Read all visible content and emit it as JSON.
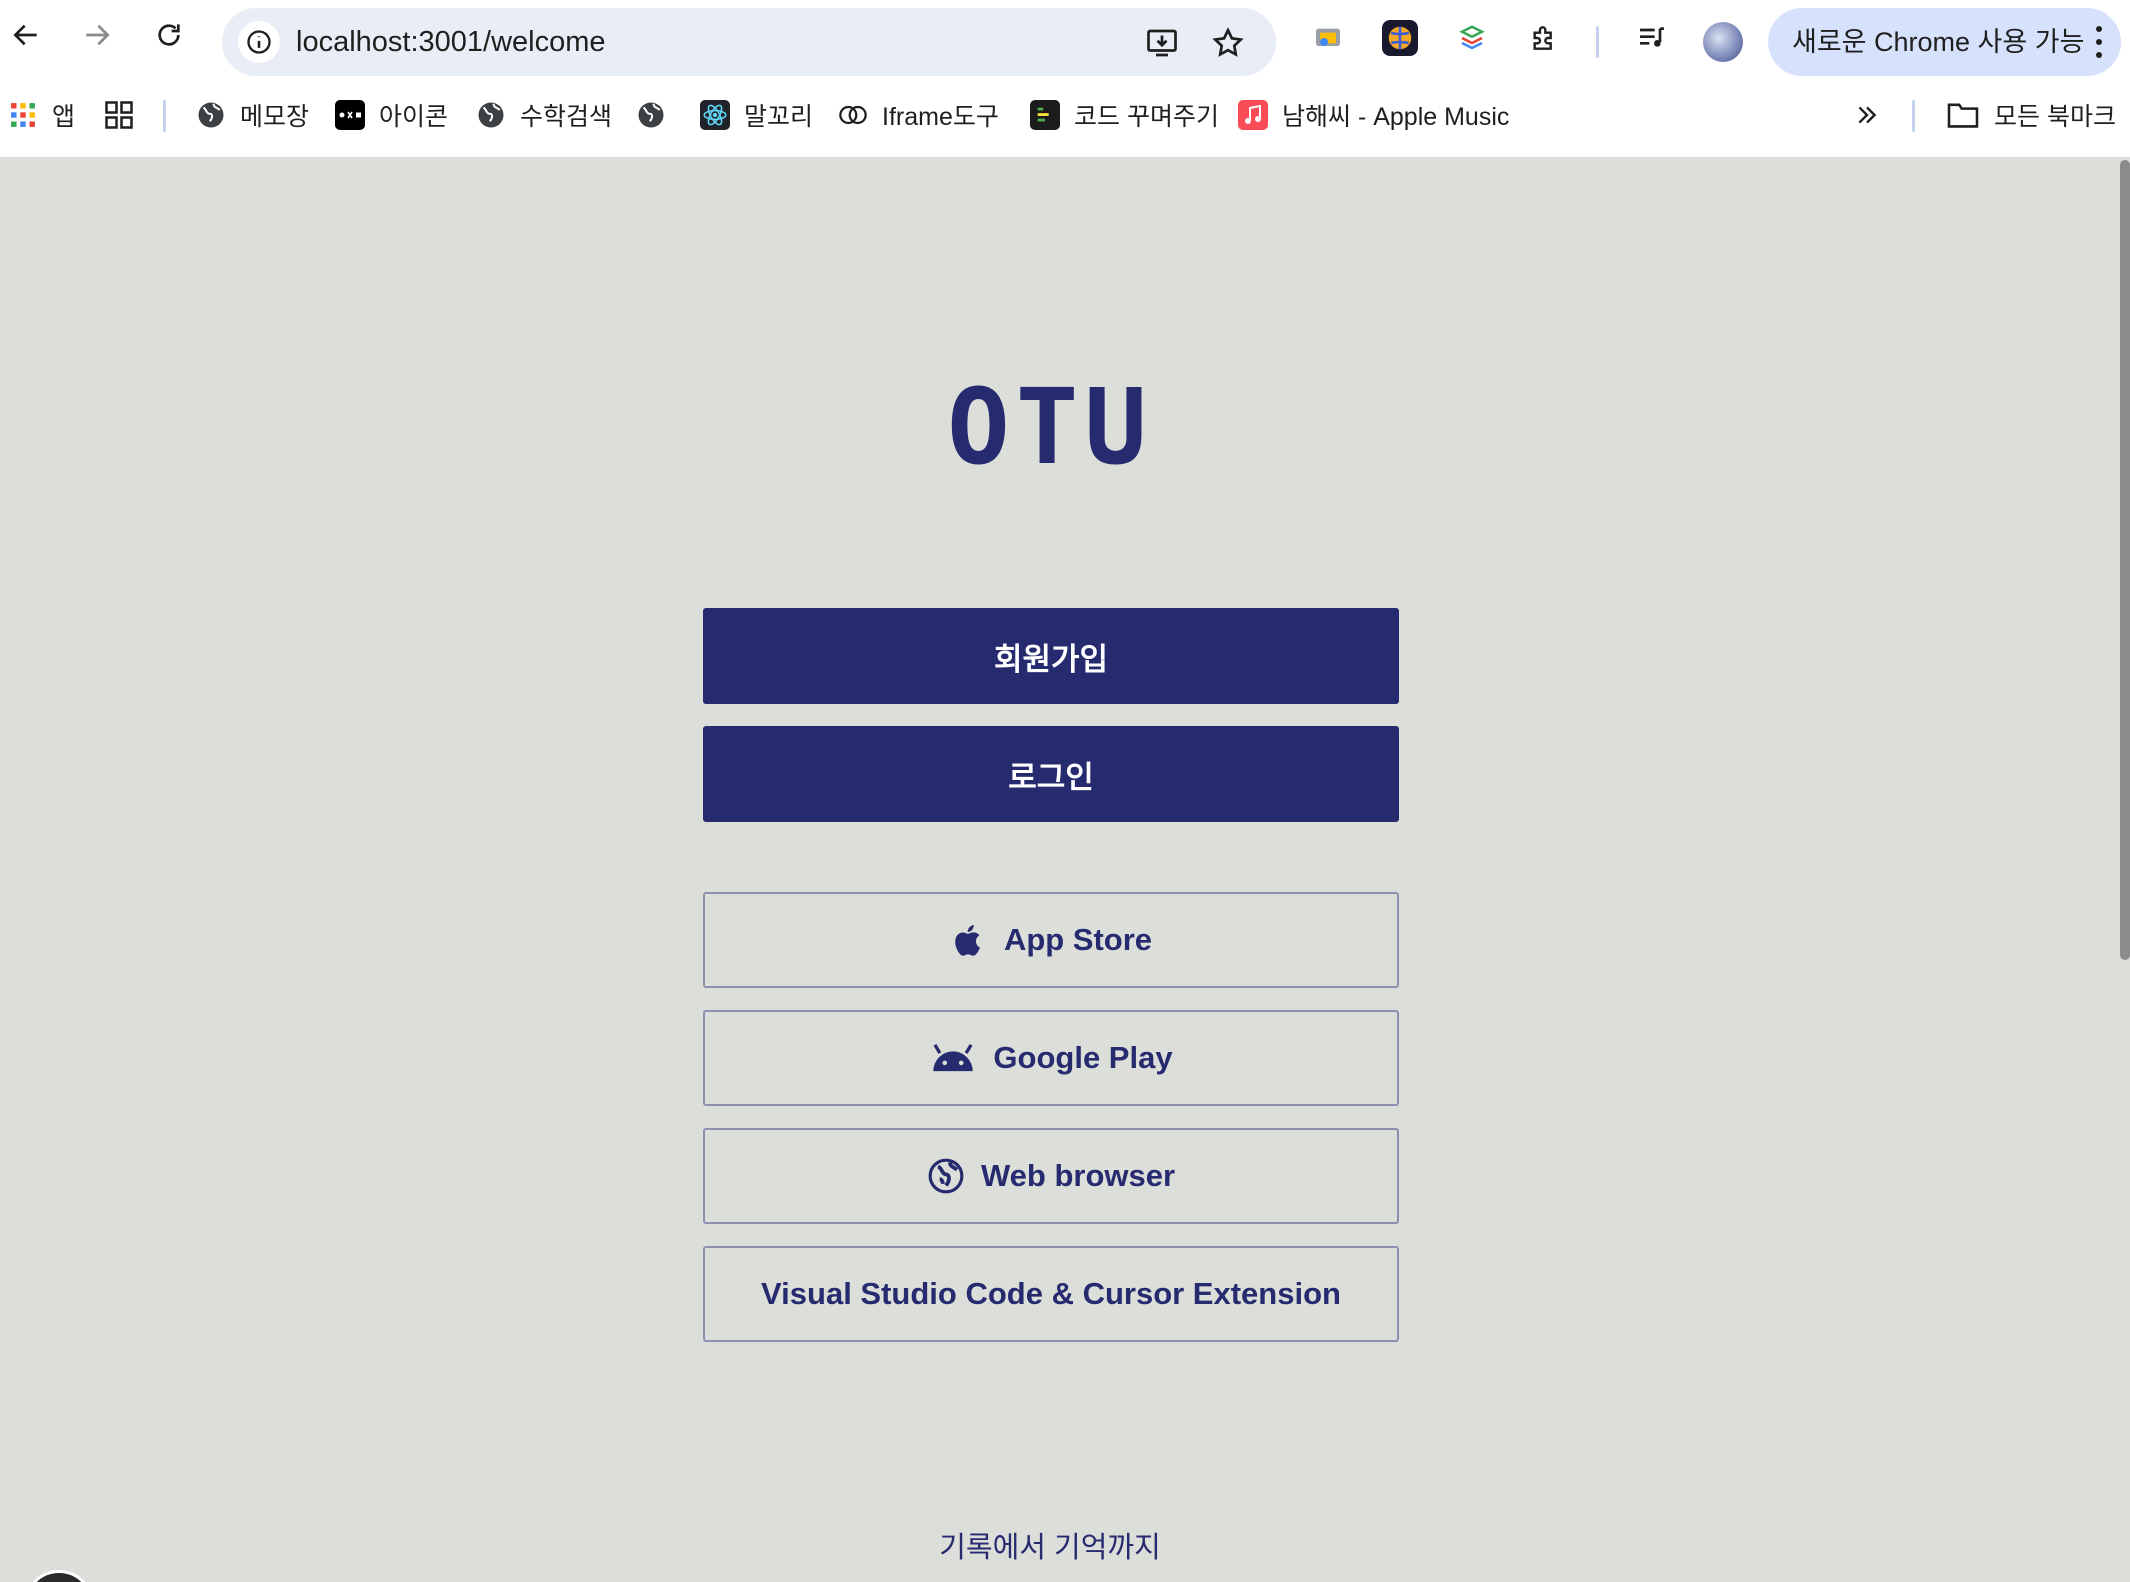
{
  "browser": {
    "url": "localhost:3001/welcome",
    "update_label": "새로운 Chrome 사용 가능"
  },
  "bookmarks": {
    "apps": "앱",
    "items": [
      "메모장",
      "아이콘",
      "수학검색",
      "",
      "말꼬리",
      "Iframe도구",
      "코드 꾸며주기",
      "남해씨 - Apple Music"
    ],
    "all_bookmarks": "모든 북마크"
  },
  "page": {
    "logo": "OTU",
    "signup_label": "회원가입",
    "login_label": "로그인",
    "app_store_label": "App Store",
    "google_play_label": "Google Play",
    "web_browser_label": "Web browser",
    "extension_label": "Visual Studio Code & Cursor Extension",
    "tagline": "기록에서 기억까지"
  },
  "colors": {
    "brand": "#262a6e",
    "page_background": "#dcdeda",
    "outline_border": "#8d91b1"
  }
}
